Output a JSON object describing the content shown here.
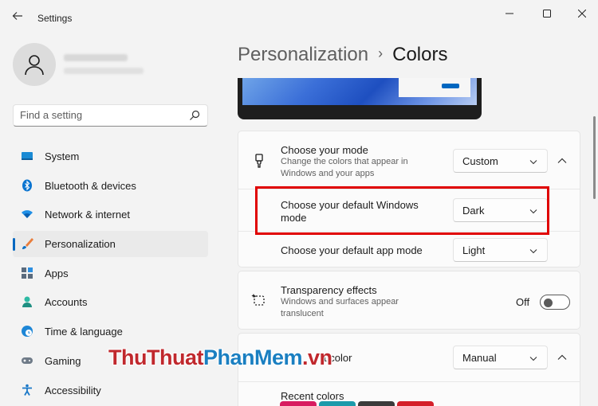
{
  "window": {
    "title": "Settings"
  },
  "search": {
    "placeholder": "Find a setting"
  },
  "sidebar": {
    "items": [
      {
        "label": "System"
      },
      {
        "label": "Bluetooth & devices"
      },
      {
        "label": "Network & internet"
      },
      {
        "label": "Personalization"
      },
      {
        "label": "Apps"
      },
      {
        "label": "Accounts"
      },
      {
        "label": "Time & language"
      },
      {
        "label": "Gaming"
      },
      {
        "label": "Accessibility"
      }
    ]
  },
  "breadcrumb": {
    "parent": "Personalization",
    "separator": "›",
    "current": "Colors"
  },
  "mode": {
    "title": "Choose your mode",
    "description": "Change the colors that appear in Windows and your apps",
    "value": "Custom",
    "windows_mode_label": "Choose your default Windows mode",
    "windows_mode_value": "Dark",
    "app_mode_label": "Choose your default app mode",
    "app_mode_value": "Light"
  },
  "transparency": {
    "title": "Transparency effects",
    "description": "Windows and surfaces appear translucent",
    "state": "Off"
  },
  "accent": {
    "title_partial": "t color",
    "value": "Manual",
    "recent_colors_label": "Recent colors",
    "recent_colors": [
      "#d81b60",
      "#1b9aaa",
      "#3b3b3b",
      "#d4202a"
    ]
  },
  "watermark": {
    "part1": "ThuThuat",
    "part2": "PhanMem",
    "part3": ".vn"
  },
  "colors": {
    "accent": "#0067c0",
    "highlight": "#e00000"
  }
}
